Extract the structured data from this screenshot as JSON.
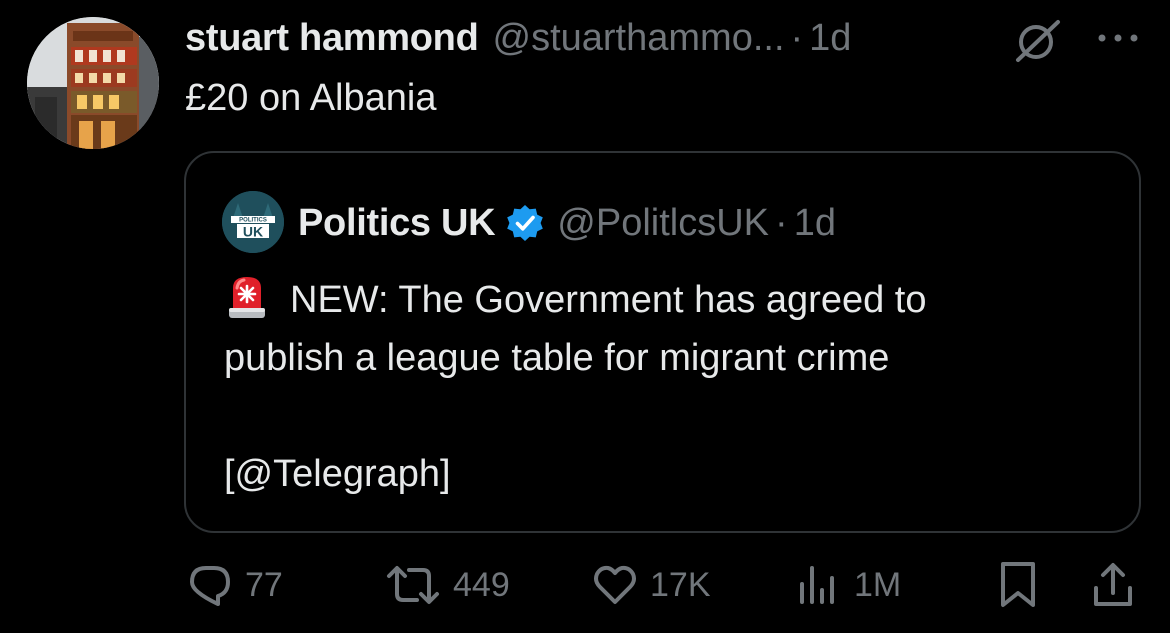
{
  "tweet": {
    "author_name": "stuart hammond",
    "author_handle": "@stuarthammo...",
    "separator": "·",
    "time": "1d",
    "text": "£20 on Albania"
  },
  "quoted_tweet": {
    "author_name": "Politics UK",
    "author_handle": "@PolitlcsUK",
    "separator": "·",
    "time": "1d",
    "avatar_text_top": "POLITICS",
    "avatar_text_bottom": "UK",
    "line1": "NEW: The Government has agreed to",
    "line2": "publish a league table for migrant crime",
    "line3": "[@Telegraph]"
  },
  "actions": {
    "replies": "77",
    "reposts": "449",
    "likes": "17K",
    "views": "1M"
  },
  "icons": {
    "grok": "grok-icon",
    "more": "more-icon",
    "verified": "verified-badge-icon",
    "siren": "siren-emoji-icon",
    "reply": "reply-icon",
    "repost": "repost-icon",
    "like": "heart-icon",
    "views": "views-chart-icon",
    "bookmark": "bookmark-icon",
    "share": "share-icon"
  },
  "colors": {
    "background": "#000000",
    "text_primary": "#e7e9ea",
    "text_secondary": "#71767b",
    "border": "#2f3336",
    "verified_blue": "#1d9bf0",
    "siren_red": "#e0202a"
  }
}
